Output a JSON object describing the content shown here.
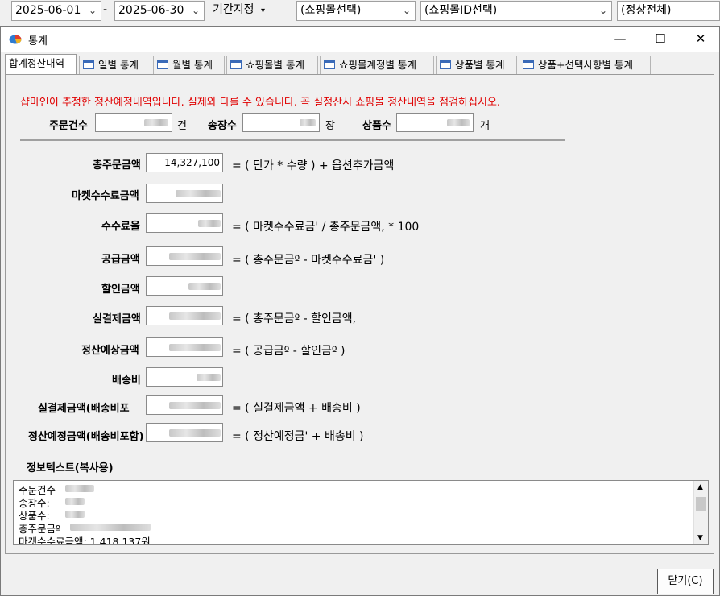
{
  "topbar": {
    "start_date": "2025-06-01",
    "dash": "-",
    "end_date": "2025-06-30",
    "period_label": "기간지정",
    "period_arrow": "▾",
    "mall_select": "(쇼핑몰선택)",
    "mall_id_select": "(쇼핑몰ID선택)",
    "status_select": "(정상전체)"
  },
  "window": {
    "title": "통계",
    "minimize": "—",
    "maximize": "☐",
    "close": "✕"
  },
  "tabs": [
    {
      "label": "합계정산내역",
      "active": true
    },
    {
      "label": "일별 통계"
    },
    {
      "label": "월별 통계"
    },
    {
      "label": "쇼핑몰별 통계"
    },
    {
      "label": "쇼핑몰계정별 통계"
    },
    {
      "label": "상품별 통계"
    },
    {
      "label": "상품+선택사항별 통계"
    }
  ],
  "notice": "샵마인이 추정한 정산예정내역입니다. 실제와 다를 수 있습니다. 꼭 실정산시 쇼핑몰 정산내역을 점검하십시오.",
  "counts": {
    "orders_label": "주문건수",
    "orders_unit": "건",
    "invoices_label": "송장수",
    "invoices_unit": "장",
    "products_label": "상품수",
    "products_unit": "개"
  },
  "rows": {
    "total_order": {
      "label": "총주문금액",
      "value": "14,327,100",
      "formula": "= ( 단가  *   수량 ) +  옵션추가금액"
    },
    "market_fee": {
      "label": "마켓수수료금액"
    },
    "fee_rate": {
      "label": "수수료율",
      "formula": "= ( 마켓수수료금'  /   총주문금액, * 100"
    },
    "supply": {
      "label": "공급금액",
      "formula": "= ( 총주문금º   -    마켓수수료금' )"
    },
    "discount": {
      "label": "할인금액"
    },
    "actual_payment": {
      "label": "실결제금액",
      "formula": "= ( 총주문금º   -    할인금액,"
    },
    "expected_settlement": {
      "label": "정산예상금액",
      "formula": "= ( 공급금º   -    할인금º )"
    },
    "shipping": {
      "label": "배송비"
    },
    "actual_payment_ship": {
      "label": "실결제금액(배송비포",
      "formula": "= (   실결제금액   +   배송비 )"
    },
    "expected_settlement_ship": {
      "label": "정산예정금액(배송비포함)",
      "formula": "= ( 정산예정금'   +   배송비 )"
    }
  },
  "info": {
    "title": "정보텍스트(복사용)",
    "lines": [
      "주문건수",
      "송장수:",
      "상품수:",
      "총주문금º",
      "마켓수수료금액: 1,418,137원"
    ]
  },
  "footer": {
    "close_button": "닫기(C)"
  }
}
